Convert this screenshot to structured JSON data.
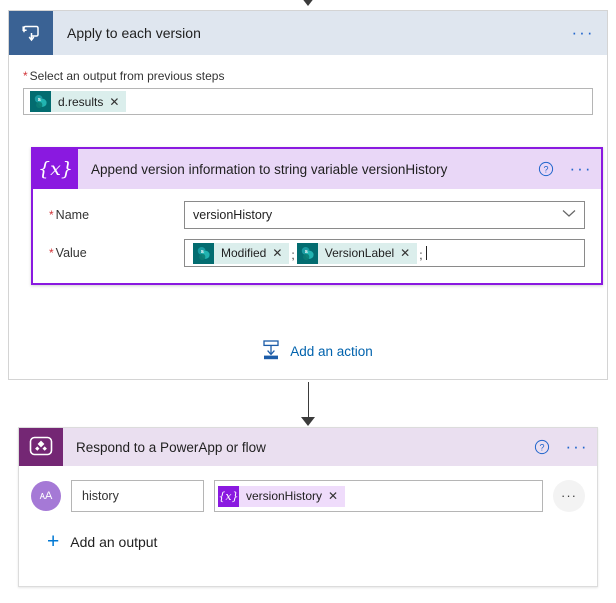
{
  "connectors": {
    "top_arrow_icon": "arrow-down-icon",
    "mid_arrow_icon": "arrow-down-icon"
  },
  "scope": {
    "icon": "apply-to-each-loop-icon",
    "title": "Apply to each version",
    "menu_icon": "ellipsis-icon",
    "menu_label": "···",
    "field": {
      "required_marker": "*",
      "label": "Select an output from previous steps",
      "token": {
        "icon": "sharepoint-icon",
        "icon_glyph": "s",
        "text": "d.results",
        "remove_label": "✕",
        "color": "#036c70"
      }
    }
  },
  "action": {
    "icon": "variables-icon",
    "icon_glyph": "{x}",
    "title": "Append version information to string variable versionHistory",
    "help_icon": "help-circle-icon",
    "menu_icon": "ellipsis-icon",
    "menu_label": "···",
    "accent_color": "#8a19e0",
    "name_field": {
      "required_marker": "*",
      "label": "Name",
      "value": "versionHistory",
      "chevron_icon": "chevron-down-icon",
      "chevron_glyph": "⌄"
    },
    "value_field": {
      "required_marker": "*",
      "label": "Value",
      "tokens": [
        {
          "icon": "sharepoint-icon",
          "icon_glyph": "s",
          "text": "Modified",
          "remove_label": "✕",
          "color": "#036c70"
        },
        {
          "icon": "sharepoint-icon",
          "icon_glyph": "s",
          "text": "VersionLabel",
          "remove_label": "✕",
          "color": "#036c70"
        }
      ],
      "separator_1": ";",
      "separator_2": ";"
    }
  },
  "add_action": {
    "icon": "insert-below-icon",
    "label": "Add an action",
    "color": "#0062ad"
  },
  "respond": {
    "icon": "powerapps-icon",
    "title": "Respond to a PowerApp or flow",
    "help_icon": "help-circle-icon",
    "menu_icon": "ellipsis-icon",
    "menu_label": "···",
    "accent_color": "#742774",
    "output": {
      "type_icon": "text-type-icon",
      "type_glyph": "ᴀA",
      "name": "history",
      "token": {
        "icon": "variables-icon",
        "icon_glyph": "{x}",
        "text": "versionHistory",
        "remove_label": "✕",
        "color": "#8a19e0"
      },
      "row_menu_icon": "ellipsis-icon",
      "row_menu_label": "···"
    },
    "add_output": {
      "icon": "plus-icon",
      "icon_glyph": "+",
      "label": "Add an output"
    }
  }
}
